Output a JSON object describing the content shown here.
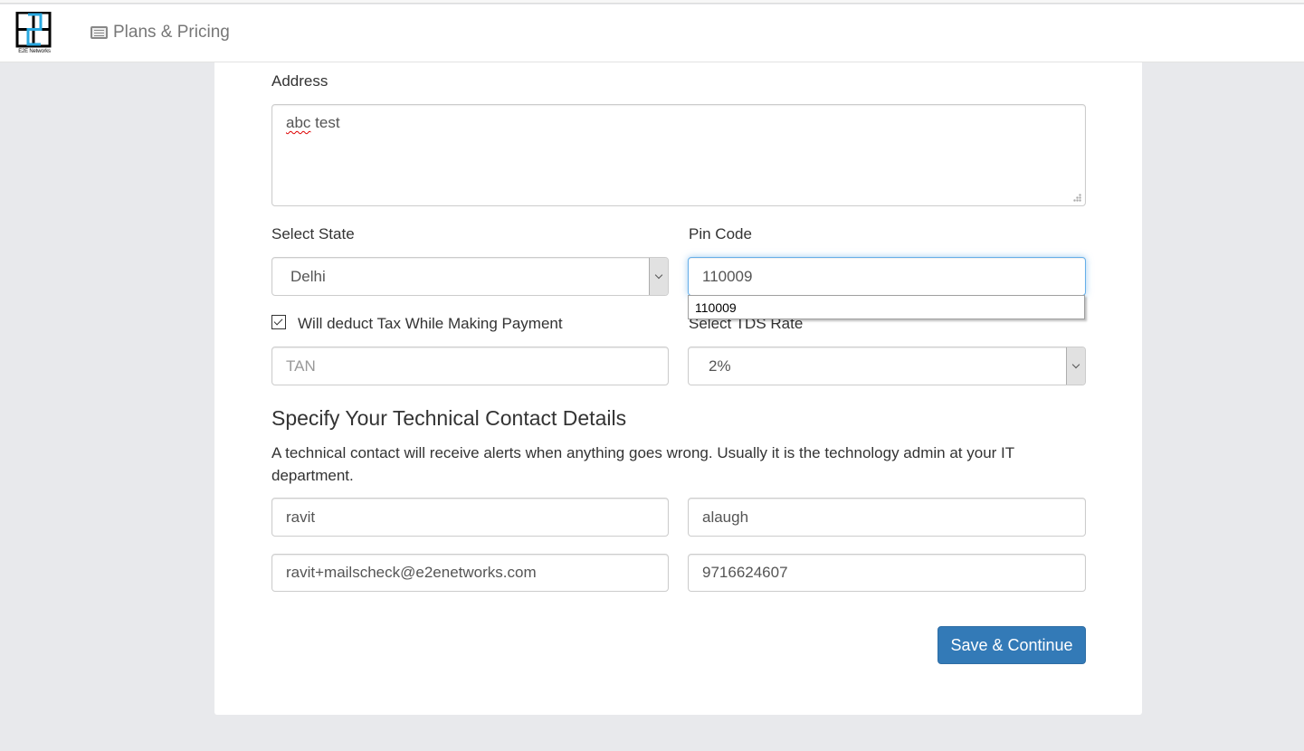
{
  "navbar": {
    "logo_text": "E2E Networks",
    "logo_colors": {
      "frame": "#000000",
      "accent": "#29a8e0"
    },
    "nav_link": {
      "icon": "list-alt-icon",
      "label": "Plans & Pricing"
    }
  },
  "form": {
    "address": {
      "label": "Address",
      "value_word1": "abc",
      "value_rest": " test"
    },
    "state": {
      "label": "Select State",
      "selected": "Delhi"
    },
    "pin_code": {
      "label": "Pin Code",
      "value": "110009",
      "autocomplete_suggestion": "110009"
    },
    "deduct_tax": {
      "label": "Will deduct Tax While Making Payment",
      "checked": true
    },
    "tan": {
      "placeholder": "TAN",
      "value": ""
    },
    "tds_rate": {
      "label": "Select TDS Rate",
      "selected": "2%"
    }
  },
  "technical_contact": {
    "heading": "Specify Your Technical Contact Details",
    "description": "A technical contact will receive alerts when anything goes wrong. Usually it is the technology admin at your IT department.",
    "first_name": "ravit",
    "last_name": "alaugh",
    "email": "ravit+mailscheck@e2enetworks.com",
    "phone": "9716624607"
  },
  "actions": {
    "save_label": "Save & Continue",
    "primary_color": "#337ab7"
  }
}
